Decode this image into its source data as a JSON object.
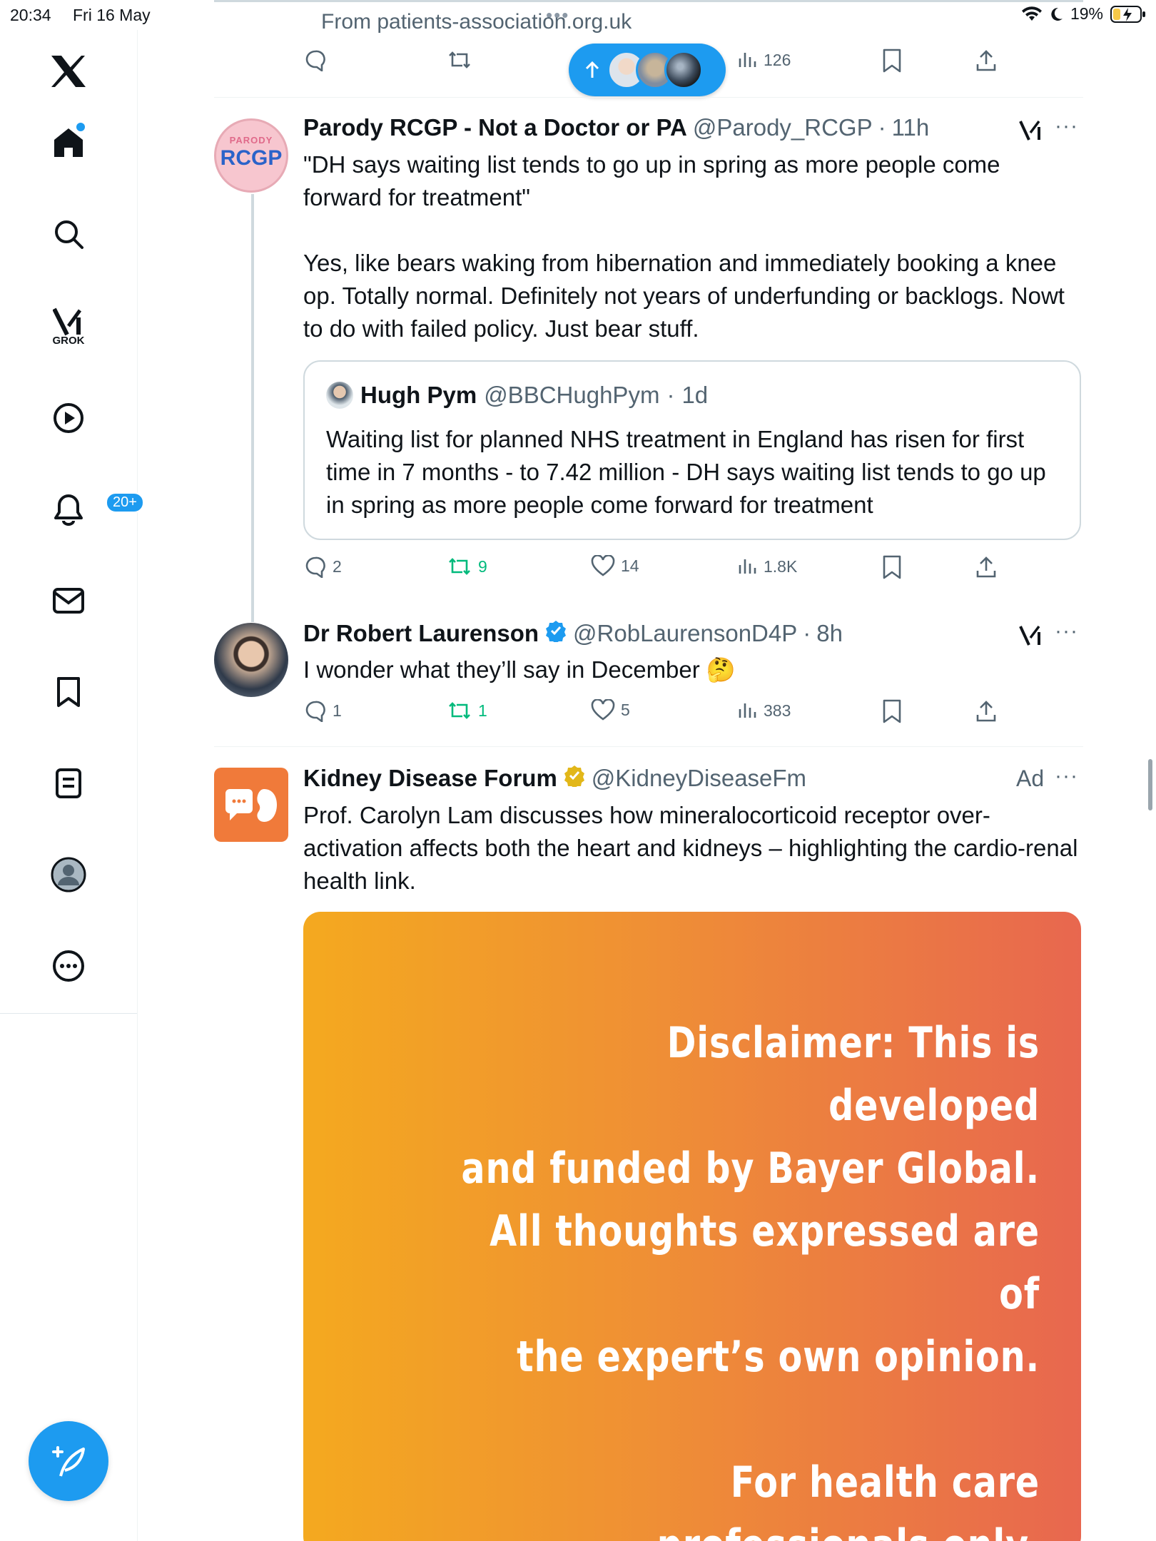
{
  "status_bar": {
    "time": "20:34",
    "date": "Fri 16 May",
    "battery": "19%"
  },
  "sidebar": {
    "grok_label": "GROK",
    "notifications_badge": "20+"
  },
  "top_post": {
    "source": "From patients-association.org.uk",
    "views": "126"
  },
  "post1": {
    "name": "Parody RCGP - Not a Doctor or PA",
    "handle": "@Parody_RCGP",
    "sep": "·",
    "time": "11h",
    "avatar_top": "PARODY",
    "avatar_main": "RCGP",
    "text": "\"DH says waiting list tends to go up in spring as more people come forward for treatment\"\n\nYes, like bears waking from hibernation and immediately booking a knee op. Totally normal. Definitely not years of underfunding or backlogs. Nowt to do with failed policy. Just bear stuff.",
    "quote": {
      "name": "Hugh Pym",
      "handle": "@BBCHughPym",
      "sep": "·",
      "time": "1d",
      "text": "Waiting list for planned NHS treatment in England has risen for first time in 7 months - to 7.42 million - DH says waiting list tends to go up in spring as more people come forward for treatment"
    },
    "replies": "2",
    "reposts": "9",
    "likes": "14",
    "views": "1.8K"
  },
  "post2": {
    "name": "Dr Robert Laurenson",
    "handle": "@RobLaurensonD4P",
    "sep": "·",
    "time": "8h",
    "text": "I wonder what they’ll say in December 🤔",
    "replies": "1",
    "reposts": "1",
    "likes": "5",
    "views": "383"
  },
  "post3": {
    "name": "Kidney Disease Forum",
    "handle": "@KidneyDiseaseFm",
    "ad_label": "Ad",
    "text": "Prof. Carolyn Lam discusses how mineralocorticoid receptor over-activation affects both the heart and kidneys – highlighting the cardio-renal health link.",
    "media_lines": [
      "Disclaimer: This is developed",
      "and funded by Bayer Global.",
      "All thoughts expressed are of",
      "the expert’s own opinion."
    ],
    "media_footer": "For health care professionals only."
  },
  "colors": {
    "accent": "#1d9bf0",
    "repost_green": "#00ba7c",
    "muted": "#536471",
    "ad_gradient_start": "#f4a91f",
    "ad_gradient_end": "#e8674f"
  }
}
